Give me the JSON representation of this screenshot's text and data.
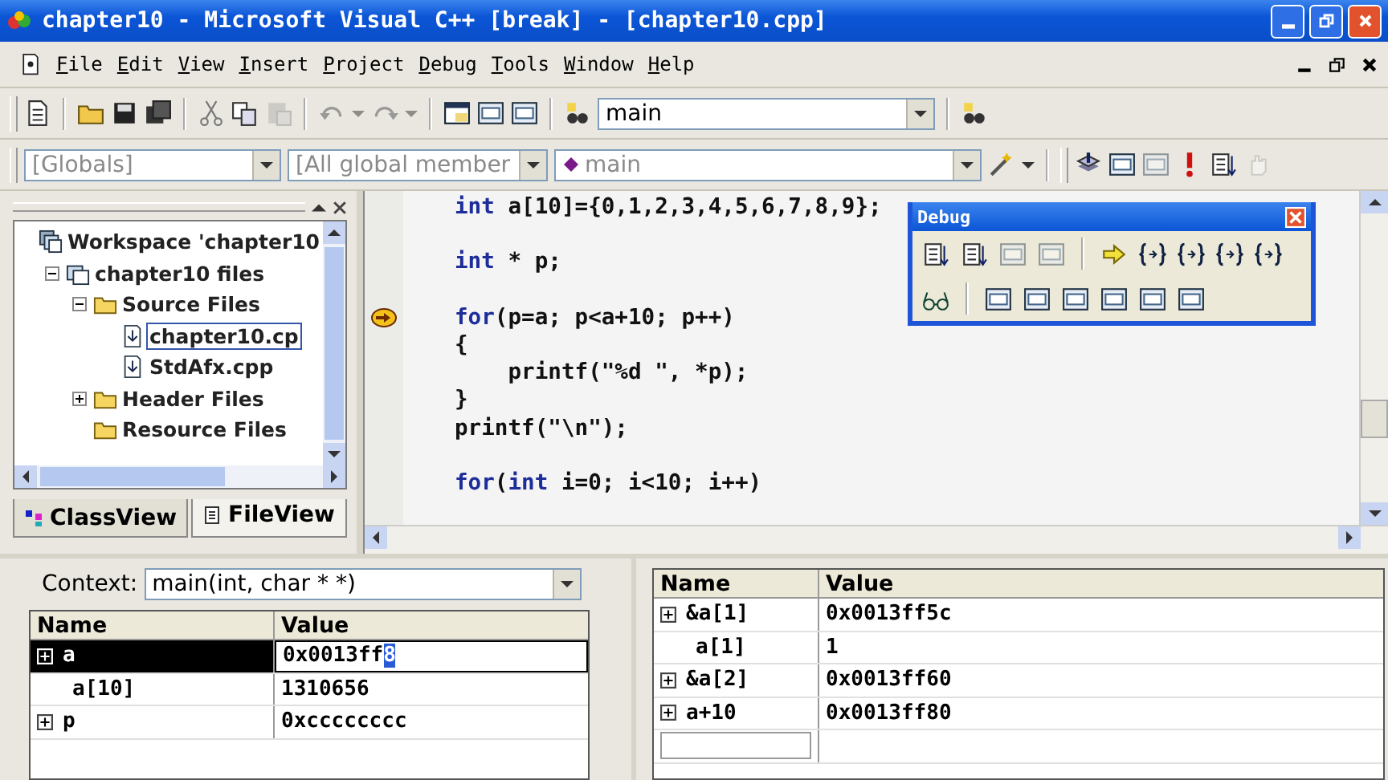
{
  "window": {
    "title": "chapter10 - Microsoft Visual C++ [break] - [chapter10.cpp]"
  },
  "menu": [
    "File",
    "Edit",
    "View",
    "Insert",
    "Project",
    "Debug",
    "Tools",
    "Window",
    "Help"
  ],
  "toolbar": {
    "find_value": "main"
  },
  "wizard_bar": {
    "class_value": "[Globals]",
    "filter_value": "[All global member",
    "member_value": "main"
  },
  "workspace": {
    "tree": [
      {
        "label": "Workspace 'chapter10",
        "kind": "workspace",
        "selected": false,
        "children": [
          {
            "label": "chapter10 files",
            "kind": "project",
            "expanded": true,
            "selected": false,
            "children": [
              {
                "label": "Source Files",
                "kind": "folder",
                "expanded": true,
                "selected": false,
                "children": [
                  {
                    "label": "chapter10.cp",
                    "kind": "file",
                    "selected": true
                  },
                  {
                    "label": "StdAfx.cpp",
                    "kind": "file",
                    "selected": false
                  }
                ]
              },
              {
                "label": "Header Files",
                "kind": "folder",
                "expanded": false,
                "selected": false
              },
              {
                "label": "Resource Files",
                "kind": "folder",
                "selected": false
              }
            ]
          }
        ]
      }
    ],
    "tabs": [
      {
        "label": "ClassView",
        "kind": "class",
        "selected": false
      },
      {
        "label": "FileView",
        "kind": "file",
        "selected": true
      }
    ]
  },
  "editor": {
    "lines": [
      {
        "current": false,
        "segments": [
          {
            "kind": "keyword",
            "text": "int"
          },
          {
            "kind": "plain",
            "text": " a[10]={0,1,2,3,4,5,6,7,8,9};"
          }
        ]
      },
      {
        "kind": "blank"
      },
      {
        "current": false,
        "segments": [
          {
            "kind": "keyword",
            "text": "int"
          },
          {
            "kind": "plain",
            "text": " * p;"
          }
        ]
      },
      {
        "kind": "blank"
      },
      {
        "current": true,
        "segments": [
          {
            "kind": "keyword",
            "text": "for"
          },
          {
            "kind": "plain",
            "text": "(p=a; p<a+10; p++)"
          }
        ]
      },
      {
        "current": false,
        "segments": [
          {
            "kind": "plain",
            "text": "{"
          }
        ]
      },
      {
        "current": false,
        "segments": [
          {
            "kind": "plain",
            "text": "    printf(\"%d \", *p);"
          }
        ]
      },
      {
        "current": false,
        "segments": [
          {
            "kind": "plain",
            "text": "}"
          }
        ]
      },
      {
        "current": false,
        "segments": [
          {
            "kind": "plain",
            "text": "printf(\"\\n\");"
          }
        ]
      },
      {
        "kind": "blank"
      },
      {
        "current": false,
        "segments": [
          {
            "kind": "keyword",
            "text": "for"
          },
          {
            "kind": "plain",
            "text": "("
          },
          {
            "kind": "keyword",
            "text": "int"
          },
          {
            "kind": "plain",
            "text": " i=0; i<10; i++)"
          }
        ]
      }
    ]
  },
  "debug_toolbar": {
    "title": "Debug"
  },
  "variables": {
    "context_label": "Context:",
    "context_value": "main(int, char * *)",
    "columns": [
      "Name",
      "Value"
    ],
    "rows": [
      {
        "name": "a",
        "expandable": true,
        "selected": true,
        "value": "0x0013ff",
        "value_selection": "8"
      },
      {
        "name": "a[10]",
        "expandable": false,
        "selected": false,
        "value": "1310656"
      },
      {
        "name": "p",
        "expandable": true,
        "selected": false,
        "value": "0xcccccccc"
      }
    ]
  },
  "watch": {
    "columns": [
      "Name",
      "Value"
    ],
    "rows": [
      {
        "name": "&a[1]",
        "expandable": true,
        "value": "0x0013ff5c"
      },
      {
        "name": "a[1]",
        "expandable": false,
        "value": "1"
      },
      {
        "name": "&a[2]",
        "expandable": true,
        "value": "0x0013ff60"
      },
      {
        "name": "a+10",
        "expandable": true,
        "value": "0x0013ff80"
      }
    ]
  }
}
